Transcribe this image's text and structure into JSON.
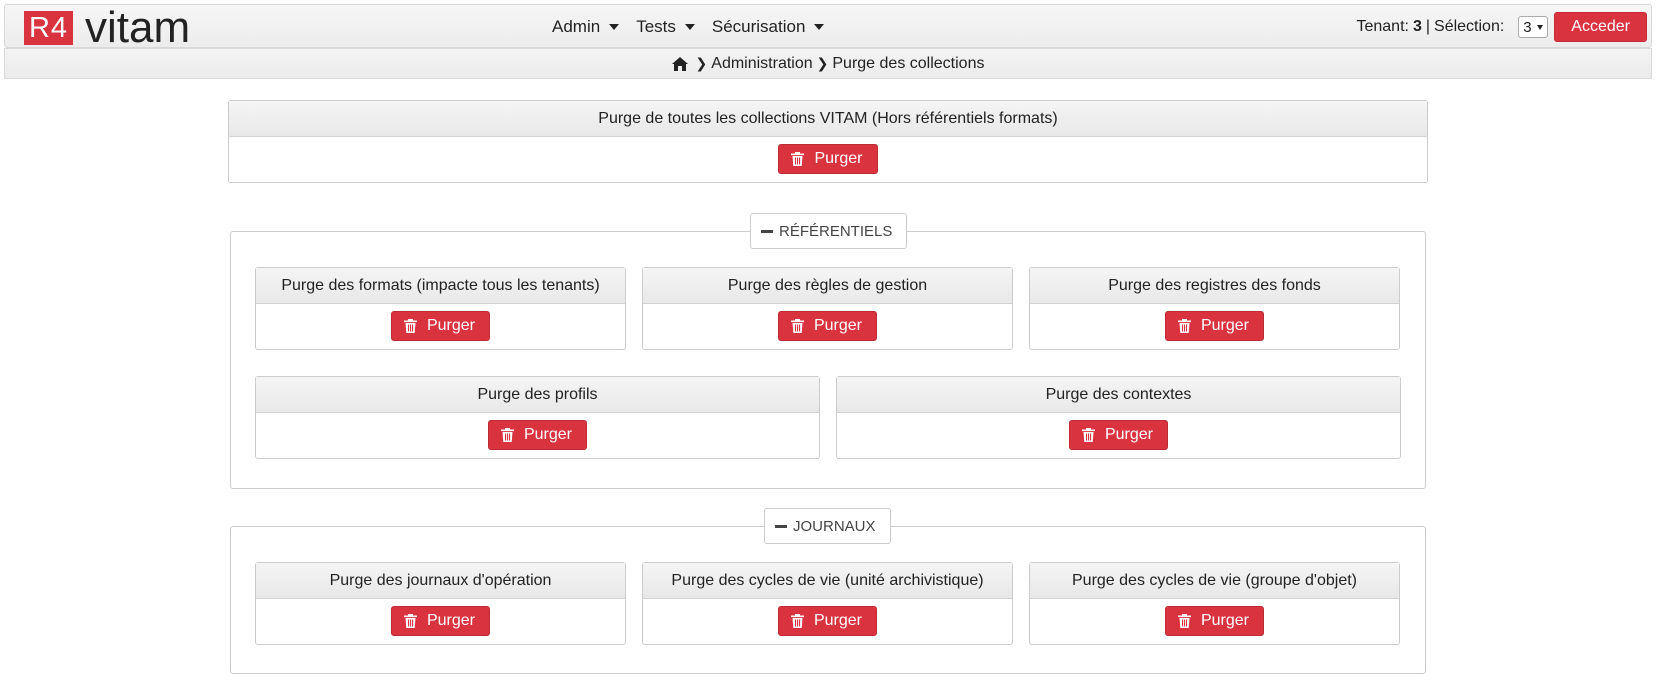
{
  "header": {
    "logo_badge": "R4",
    "logo_text": "vitam",
    "menu": [
      {
        "label": "Admin"
      },
      {
        "label": "Tests"
      },
      {
        "label": "Sécurisation"
      }
    ],
    "tenant_label": "Tenant:",
    "tenant_value": "3",
    "separator": "|",
    "selection_label": "Sélection:",
    "selection_value": "3",
    "acceder_label": "Acceder"
  },
  "breadcrumb": {
    "items": [
      "Administration",
      "Purge des collections"
    ]
  },
  "purge_label": "Purger",
  "main_panel": {
    "title": "Purge de toutes les collections VITAM (Hors référentiels formats)"
  },
  "referentiels": {
    "legend": "RÉFÉRENTIELS",
    "panels": [
      {
        "title": "Purge des formats (impacte tous les tenants)"
      },
      {
        "title": "Purge des règles de gestion"
      },
      {
        "title": "Purge des registres des fonds"
      },
      {
        "title": "Purge des profils"
      },
      {
        "title": "Purge des contextes"
      }
    ]
  },
  "journaux": {
    "legend": "JOURNAUX",
    "panels": [
      {
        "title": "Purge des journaux d'opération"
      },
      {
        "title": "Purge des cycles de vie (unité archivistique)"
      },
      {
        "title": "Purge des cycles de vie (groupe d'objet)"
      }
    ]
  },
  "colors": {
    "accent": "#d9333f",
    "header_bg": "#f0f0f0",
    "border": "#cccccc"
  }
}
